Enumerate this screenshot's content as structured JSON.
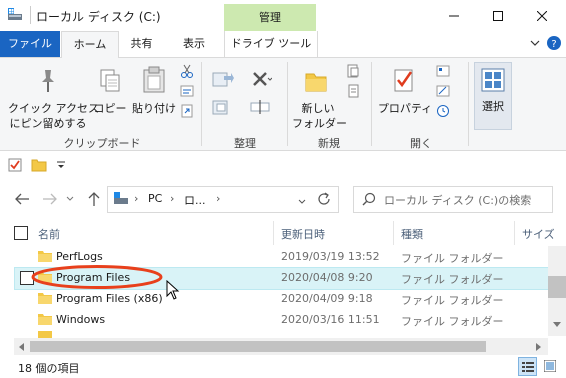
{
  "window": {
    "title": "ローカル ディスク (C:)",
    "context_tab_header": "管理",
    "minimize": "—",
    "maximize": "☐",
    "close": "✕"
  },
  "tabs": [
    {
      "label": "ファイル"
    },
    {
      "label": "ホーム"
    },
    {
      "label": "共有"
    },
    {
      "label": "表示"
    },
    {
      "label": "ドライブ ツール"
    }
  ],
  "ribbon": {
    "pin_label_1": "クイック アクセス",
    "pin_label_2": "にピン留めする",
    "copy": "コピー",
    "paste": "貼り付け",
    "group_clipboard": "クリップボード",
    "group_organize": "整理",
    "new_folder_1": "新しい",
    "new_folder_2": "フォルダー",
    "group_new": "新規",
    "properties": "プロパティ",
    "group_open": "開く",
    "select": "選択"
  },
  "address": {
    "crumb_pc": "PC",
    "crumb_drive": "ロ...",
    "search_placeholder": "ローカル ディスク (C:)の検索"
  },
  "columns": {
    "name": "名前",
    "modified": "更新日時",
    "type": "種類",
    "size": "サイズ"
  },
  "files": [
    {
      "name": "PerfLogs",
      "modified": "2019/03/19 13:52",
      "type": "ファイル フォルダー"
    },
    {
      "name": "Program Files",
      "modified": "2020/04/08 9:20",
      "type": "ファイル フォルダー"
    },
    {
      "name": "Program Files (x86)",
      "modified": "2020/04/09 9:18",
      "type": "ファイル フォルダー"
    },
    {
      "name": "Windows",
      "modified": "2020/03/16 11:51",
      "type": "ファイル フォルダー"
    }
  ],
  "status": {
    "count": "18 個の項目"
  },
  "colors": {
    "file_tab": "#1a65c2",
    "context_tab": "#cde9b0",
    "row_highlight": "#d9f3f7",
    "annotation": "#e8401c",
    "folder": "#f3c846"
  },
  "icons": [
    "drive-icon",
    "pin-icon",
    "copy-icon",
    "paste-icon",
    "cut-icon",
    "delete-icon",
    "rename-icon",
    "new-folder-icon",
    "properties-icon",
    "select-icon",
    "folder-icon",
    "back-icon",
    "forward-icon",
    "up-icon",
    "refresh-icon",
    "search-icon",
    "details-view-icon",
    "large-icons-view-icon",
    "cursor-icon"
  ]
}
